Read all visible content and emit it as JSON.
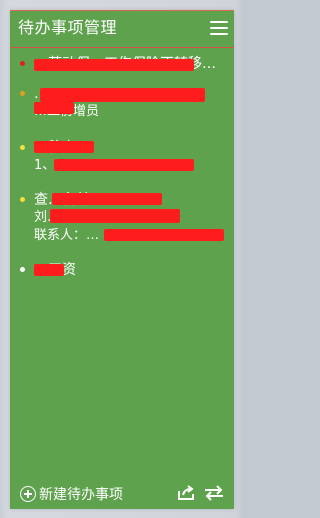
{
  "header": {
    "title": "待办事项管理"
  },
  "items": [
    {
      "dot_color": "#e02020",
      "line1": "…劳动保…工伤保险不转移…",
      "line2": ""
    },
    {
      "dot_color": "#e0a020",
      "line1": "…",
      "line2": "…工伤增员"
    },
    {
      "dot_color": "#f0e040",
      "line1": "…移交",
      "line2": "1、…"
    },
    {
      "dot_color": "#f0e040",
      "line1": "查…名单",
      "line2": "刘…/308…",
      "line3": "联系人：…"
    },
    {
      "dot_color": "#ffffff",
      "line1": "…工资"
    }
  ],
  "footer": {
    "add_label": "新建待办事项"
  }
}
